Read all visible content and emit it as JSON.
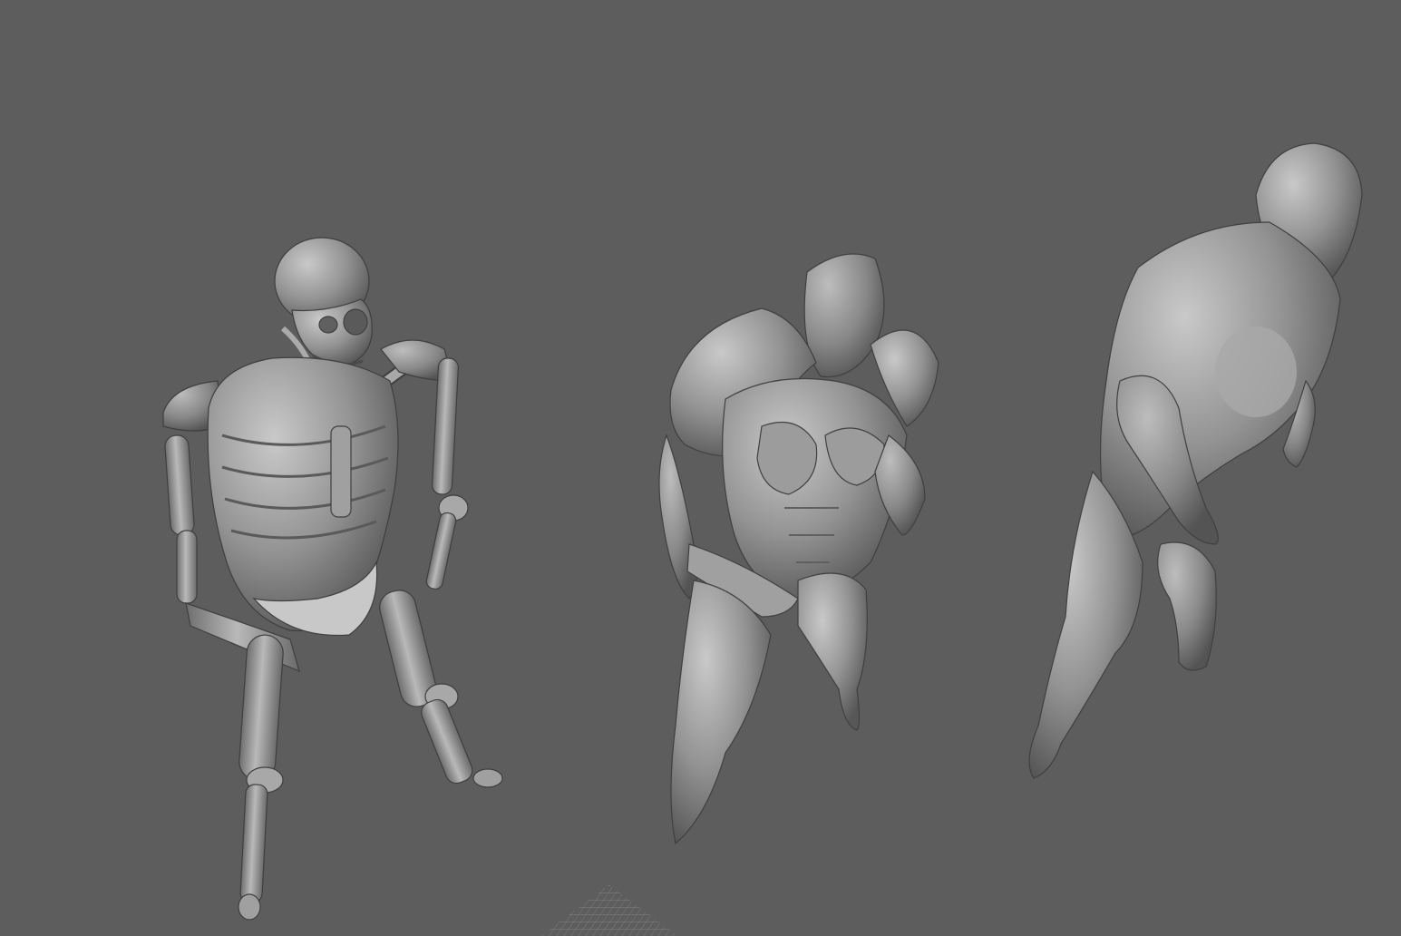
{
  "viewport": {
    "background": "#5d5d5d",
    "shading": {
      "highlight": "#c6c6c6",
      "base": "#8c8c8c",
      "shadow": "#4a4a4a",
      "outline": "#3c3c3c"
    }
  },
  "models": [
    {
      "id": "skeleton",
      "name": "skeleton-model"
    },
    {
      "id": "muscle",
      "name": "muscle-model"
    },
    {
      "id": "body",
      "name": "body-model"
    }
  ],
  "grid": {
    "visible": true,
    "color": "#8a8a8a"
  }
}
